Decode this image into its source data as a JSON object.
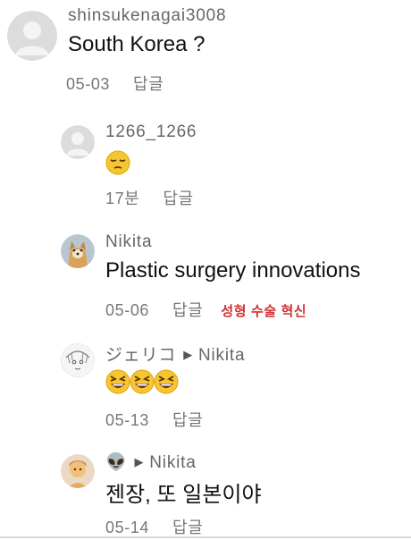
{
  "comments": [
    {
      "username": "shinsukenagai3008",
      "text": "South Korea ?",
      "date": "05-03",
      "reply_label": "답글"
    },
    {
      "username": "1266_1266",
      "emoji": [
        "pensive-face"
      ],
      "date": "17분",
      "reply_label": "답글"
    },
    {
      "username": "Nikita",
      "text": "Plastic surgery innovations",
      "date": "05-06",
      "reply_label": "답글",
      "translation": "성형 수술 혁신"
    },
    {
      "username": "ジェリコ",
      "reply_to": "Nikita",
      "emoji": [
        "grinning-squinting-face",
        "grinning-squinting-face",
        "grinning-squinting-face"
      ],
      "date": "05-13",
      "reply_label": "답글"
    },
    {
      "username": "👽",
      "reply_to": "Nikita",
      "text": "젠장, 또 일본이야",
      "date": "05-14",
      "reply_label": "답글"
    }
  ],
  "colors": {
    "translation": "#d32f2f",
    "meta": "#777777",
    "username": "#666666"
  }
}
